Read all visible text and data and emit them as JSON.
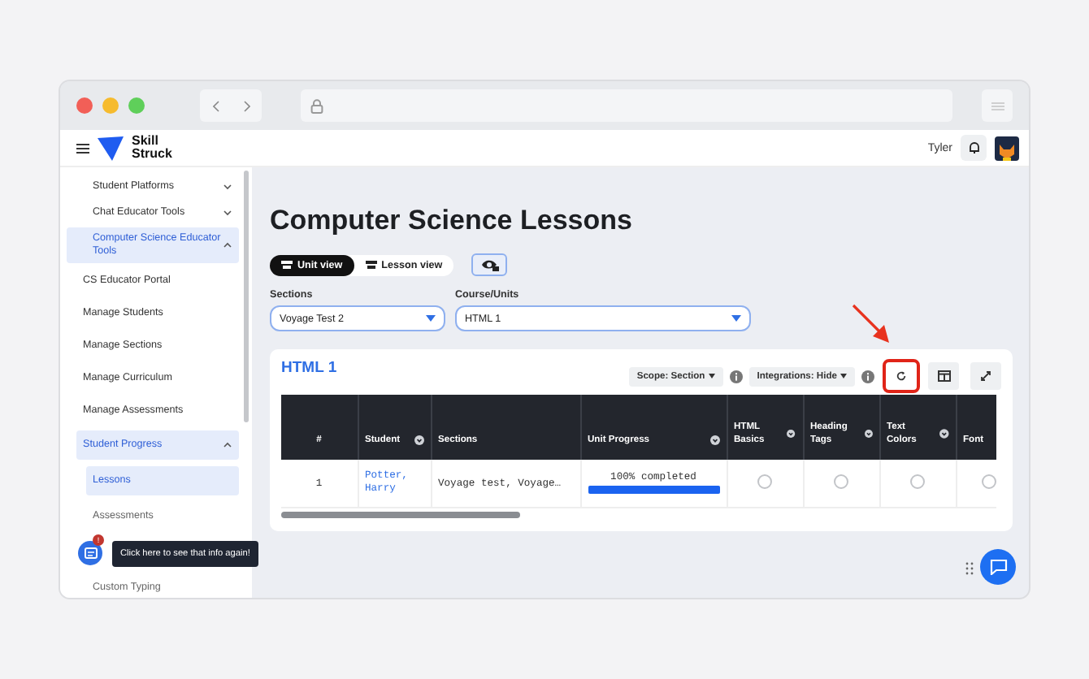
{
  "header": {
    "brand_line_1": "Skill",
    "brand_line_2": "Struck",
    "user_name": "Tyler"
  },
  "sidebar": {
    "items": [
      {
        "label": "Student Platforms",
        "expanded": false,
        "selected": false
      },
      {
        "label": "Chat Educator Tools",
        "expanded": false,
        "selected": false
      },
      {
        "label": "Computer Science Educator Tools",
        "expanded": true,
        "selected": true,
        "children": [
          {
            "label": "CS Educator Portal",
            "selected": false
          },
          {
            "label": "Manage Students",
            "selected": false
          },
          {
            "label": "Manage Sections",
            "selected": false
          },
          {
            "label": "Manage Curriculum",
            "selected": false
          },
          {
            "label": "Manage Assessments",
            "selected": false
          },
          {
            "label": "Student Progress",
            "selected": true,
            "expanded": true,
            "children": [
              {
                "label": "Lessons",
                "selected": true
              },
              {
                "label": "Assessments",
                "selected": false
              },
              {
                "label": "Custom Typing",
                "selected": false
              }
            ]
          }
        ]
      }
    ]
  },
  "tooltip": {
    "text": "Click here to see that info again!",
    "badge": "!"
  },
  "page_title": "Computer Science Lessons",
  "view_toggle": [
    {
      "label": "Unit view",
      "selected": true
    },
    {
      "label": "Lesson view",
      "selected": false
    }
  ],
  "filters": [
    {
      "label": "Sections",
      "value": "Voyage Test 2"
    },
    {
      "label": "Course/Units",
      "value": "HTML 1"
    }
  ],
  "card": {
    "title": "HTML 1",
    "toolbar": [
      {
        "kind": "dropdown",
        "label": "Scope: Section"
      },
      {
        "kind": "info"
      },
      {
        "kind": "dropdown",
        "label": "Integrations: Hide"
      },
      {
        "kind": "info"
      },
      {
        "kind": "refresh",
        "highlighted": true
      },
      {
        "kind": "columns",
        "highlighted": false
      },
      {
        "kind": "expand",
        "highlighted": false
      }
    ],
    "table": {
      "columns": [
        {
          "label": "#",
          "sortable": false
        },
        {
          "label": "Student",
          "sortable": true
        },
        {
          "label": "Sections",
          "sortable": false
        },
        {
          "label": "Unit Progress",
          "sortable": true
        },
        {
          "label": "HTML Basics",
          "sortable": true
        },
        {
          "label": "Heading Tags",
          "sortable": true
        },
        {
          "label": "Text Colors",
          "sortable": true
        },
        {
          "label": "Font"
        }
      ],
      "rows": [
        {
          "number": "1",
          "student": "Potter, Harry",
          "sections": "Voyage test, Voyage…",
          "progress": {
            "reading": "100% completed",
            "level": 1
          },
          "lessons": [
            {
              "done": false
            },
            {
              "done": false
            },
            {
              "done": false
            },
            {
              "done": false
            }
          ]
        }
      ]
    }
  }
}
